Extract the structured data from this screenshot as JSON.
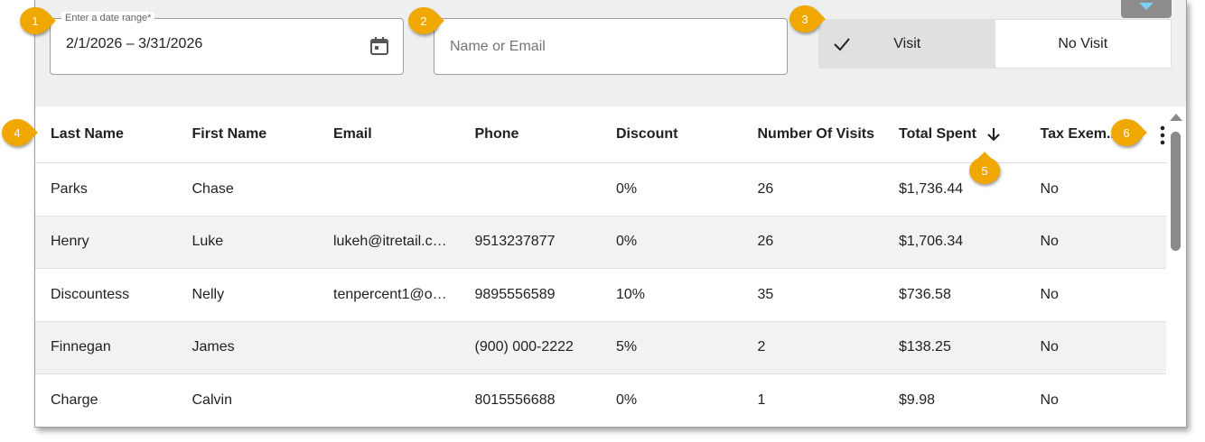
{
  "filters": {
    "date_label": "Enter a date range*",
    "date_value": "2/1/2026 – 3/31/2026",
    "search_placeholder": "Name or Email",
    "visit_label": "Visit",
    "no_visit_label": "No Visit",
    "selected": "Visit"
  },
  "table": {
    "headers": [
      "Last Name",
      "First Name",
      "Email",
      "Phone",
      "Discount",
      "Number Of Visits",
      "Total Spent",
      "Tax Exem..."
    ],
    "sort_column": "Total Spent",
    "sort_direction": "descending",
    "rows": [
      [
        "Parks",
        "Chase",
        "",
        "",
        "0%",
        "26",
        "$1,736.44",
        "No"
      ],
      [
        "Henry",
        "Luke",
        "lukeh@itretail.c…",
        "9513237877",
        "0%",
        "26",
        "$1,706.34",
        "No"
      ],
      [
        "Discountess",
        "Nelly",
        "tenpercent1@o…",
        "9895556589",
        "10%",
        "35",
        "$736.58",
        "No"
      ],
      [
        "Finnegan",
        "James",
        "",
        "(900) 000-2222",
        "5%",
        "2",
        "$138.25",
        "No"
      ],
      [
        "Charge",
        "Calvin",
        "",
        "8015556688",
        "0%",
        "1",
        "$9.98",
        "No"
      ]
    ]
  },
  "callouts": [
    "1",
    "2",
    "3",
    "4",
    "5",
    "6"
  ],
  "colors": {
    "callout": "#f0a800",
    "filter_background": "#eef0f0",
    "toggle_selected": "#e0e0e0",
    "row_alt": "#f2f2f2"
  },
  "icons": {
    "date": "calendar-icon",
    "toggle": "check-icon",
    "sort": "arrow-down-icon",
    "menu": "more-vert-icon",
    "collapse": "chevron-down-icon"
  }
}
